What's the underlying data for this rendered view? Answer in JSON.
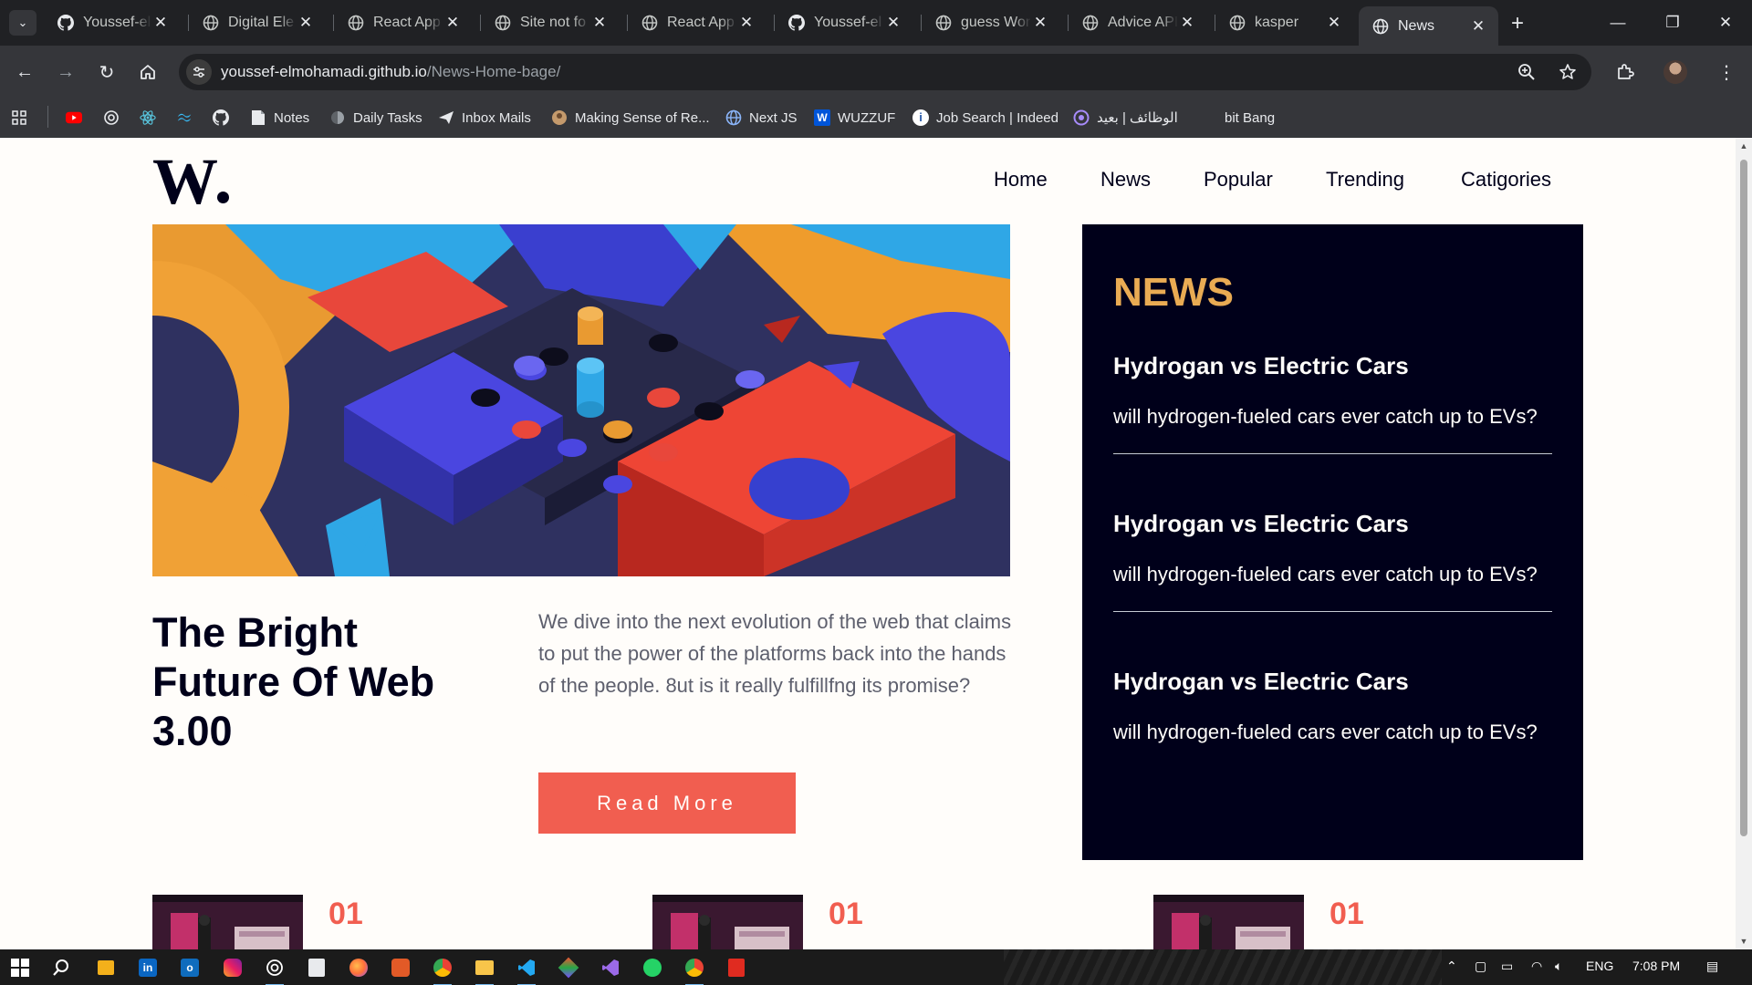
{
  "browser": {
    "tabs": [
      {
        "title": "Youssef-el",
        "icon": "github-icon"
      },
      {
        "title": "Digital Ele",
        "icon": "globe-icon"
      },
      {
        "title": "React App",
        "icon": "globe-icon"
      },
      {
        "title": "Site not fo",
        "icon": "globe-icon"
      },
      {
        "title": "React App",
        "icon": "globe-icon"
      },
      {
        "title": "Youssef-el",
        "icon": "github-icon"
      },
      {
        "title": "guess Wor",
        "icon": "globe-icon"
      },
      {
        "title": "Advice API",
        "icon": "globe-icon"
      },
      {
        "title": "kasper",
        "icon": "globe-icon"
      },
      {
        "title": "News",
        "icon": "globe-icon",
        "active": true
      }
    ],
    "url_host": "youssef-elmohamadi.github.io",
    "url_path": "/News-Home-bage/",
    "bookmarks": [
      {
        "label": "",
        "icon": "youtube-icon"
      },
      {
        "label": "",
        "icon": "chatgpt-icon"
      },
      {
        "label": "",
        "icon": "react-icon"
      },
      {
        "label": "",
        "icon": "tailwind-icon"
      },
      {
        "label": "",
        "icon": "github-icon"
      },
      {
        "label": "Notes",
        "icon": "notes-icon"
      },
      {
        "label": "Daily Tasks",
        "icon": "tasks-icon"
      },
      {
        "label": "Inbox Mails",
        "icon": "mail-icon"
      },
      {
        "label": "Making Sense of Re...",
        "icon": "avatar-icon"
      },
      {
        "label": "Next JS",
        "icon": "globe-icon"
      },
      {
        "label": "WUZZUF",
        "icon": "wuzzuf-icon"
      },
      {
        "label": "Job Search | Indeed",
        "icon": "indeed-icon"
      },
      {
        "label": "الوظائف | بعيد",
        "icon": "remote-icon"
      },
      {
        "label": "bit Bang",
        "icon": "blank-icon"
      }
    ]
  },
  "site": {
    "logo": "W",
    "nav": [
      "Home",
      "News",
      "Popular",
      "Trending",
      "Catigories"
    ],
    "headline": "The Bright Future Of Web 3.00",
    "lede": "We dive into the next evolution of the web that claims to put the power of the platforms back into the hands of the people. 8ut is it really fulfillfng its promise?",
    "cta": "Read More",
    "sidebar": {
      "title": "NEWS",
      "items": [
        {
          "title": "Hydrogan vs Electric Cars",
          "desc": "will hydrogen-fueled cars ever catch up to EVs?"
        },
        {
          "title": "Hydrogan vs Electric Cars",
          "desc": "will hydrogen-fueled cars ever catch up to EVs?"
        },
        {
          "title": "Hydrogan vs Electric Cars",
          "desc": "will hydrogen-fueled cars ever catch up to EVs?"
        }
      ]
    },
    "cards": [
      {
        "num": "01"
      },
      {
        "num": "01"
      },
      {
        "num": "01"
      }
    ],
    "colors": {
      "dark": "#00001a",
      "accent": "#f15e50",
      "gold": "#e9ab53",
      "bg": "#fffdfa"
    }
  },
  "taskbar": {
    "language": "ENG",
    "time": "7:08 PM"
  }
}
